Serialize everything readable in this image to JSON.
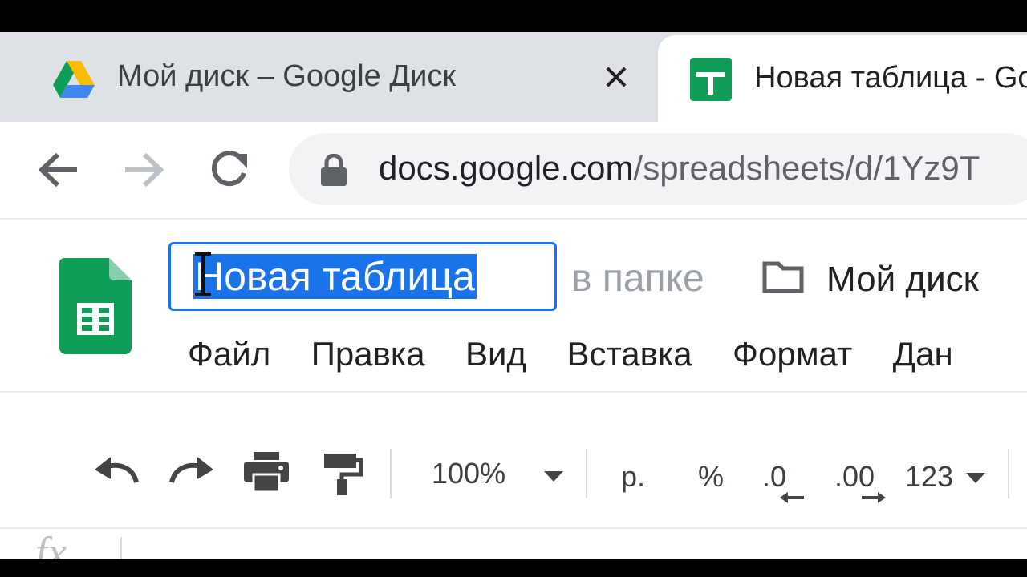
{
  "browser": {
    "tabs": [
      {
        "title": "Мой диск – Google Диск",
        "icon": "google-drive-icon",
        "active": false
      },
      {
        "title": "Новая таблица - Go",
        "icon": "google-sheets-icon",
        "active": true
      }
    ],
    "url": {
      "host": "docs.google.com",
      "path": "/spreadsheets/d/1Yz9T"
    }
  },
  "sheets": {
    "doc_title": "Новая таблица",
    "folder_prefix": "в папке",
    "folder_name": "Мой диск",
    "menu": [
      "Файл",
      "Правка",
      "Вид",
      "Вставка",
      "Формат",
      "Дан"
    ],
    "toolbar": {
      "zoom": "100%",
      "currency": "р.",
      "percent": "%",
      "decrease_decimals": ".0",
      "increase_decimals": ".00",
      "more_formats": "123"
    },
    "formula_label": "fx"
  },
  "colors": {
    "accent": "#1a73e8",
    "sheets_green": "#0f9d58"
  }
}
